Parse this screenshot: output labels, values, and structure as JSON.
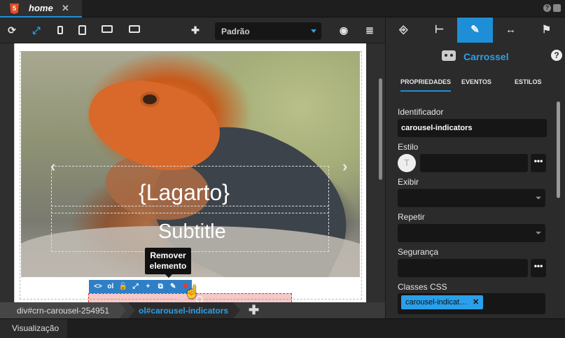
{
  "tab": {
    "title": "home",
    "icon": "html5-icon",
    "close": "✕"
  },
  "window_icons": [
    "?",
    "■"
  ],
  "toolbar": {
    "icons": [
      "refresh-icon",
      "expand-icon",
      "phone-icon",
      "tablet-icon",
      "desktop-icon",
      "monitor-icon",
      "add-icon",
      "visibility-icon",
      "database-icon"
    ],
    "add": "✚",
    "select_value": "Padrão"
  },
  "canvas": {
    "caption_title": "{Lagarto}",
    "caption_subtitle": "Subtitle",
    "tooltip_line1": "Remover",
    "tooltip_line2": "elemento",
    "element_toolbar": [
      "<>",
      "ol",
      "🔓",
      "⤢",
      "+",
      "⧉",
      "✎",
      "✖"
    ]
  },
  "breadcrumb": {
    "items": [
      "div#crn-carousel-254951",
      "ol#carousel-indicators"
    ],
    "add": "✚"
  },
  "bottom": {
    "tab": "Visualização"
  },
  "panel": {
    "tabs": [
      "⎆",
      "⊢",
      "✎",
      "↔",
      "⚑"
    ],
    "component_name": "Carrossel",
    "help": "?",
    "subtabs": [
      "PROPRIEDADES",
      "EVENTOS",
      "ESTILOS"
    ],
    "fields": {
      "identificador_label": "Identificador",
      "identificador_value": "carousel-indicators",
      "estilo_label": "Estilo",
      "estilo_icon": "T",
      "exibir_label": "Exibir",
      "repetir_label": "Repetir",
      "seguranca_label": "Segurança",
      "classes_label": "Classes CSS",
      "classes_chip": "carousel-indicat…",
      "chip_close": "✕",
      "dots": "•••"
    }
  },
  "colors": {
    "accent": "#1e8fd6",
    "link": "#2aa0ea",
    "danger": "#e53935"
  }
}
